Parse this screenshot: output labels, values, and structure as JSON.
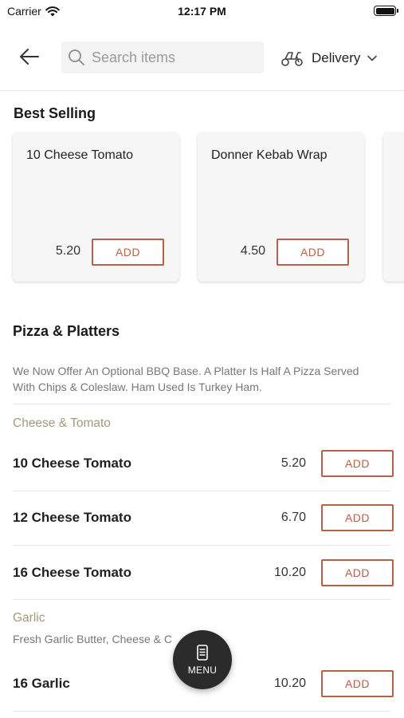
{
  "status_bar": {
    "carrier": "Carrier",
    "time": "12:17 PM"
  },
  "header": {
    "search_placeholder": "Search items",
    "delivery_label": "Delivery"
  },
  "best_selling": {
    "title": "Best Selling",
    "cards": [
      {
        "name": "10 Cheese Tomato",
        "price": "5.20",
        "add_label": "ADD"
      },
      {
        "name": "Donner Kebab Wrap",
        "price": "4.50",
        "add_label": "ADD"
      }
    ]
  },
  "pizza": {
    "title": "Pizza & Platters",
    "description": "We Now Offer An Optional BBQ Base. A Platter Is Half A Pizza Served With Chips & Coleslaw. Ham Used Is Turkey Ham.",
    "subcategories": [
      {
        "title": "Cheese & Tomato",
        "items": [
          {
            "name": "10 Cheese Tomato",
            "price": "5.20",
            "add_label": "ADD"
          },
          {
            "name": "12 Cheese Tomato",
            "price": "6.70",
            "add_label": "ADD"
          },
          {
            "name": "16 Cheese Tomato",
            "price": "10.20",
            "add_label": "ADD"
          }
        ]
      },
      {
        "title": "Garlic",
        "description": "Fresh Garlic Butter, Cheese & C",
        "items": [
          {
            "name": "16 Garlic",
            "price": "10.20",
            "add_label": "ADD"
          }
        ]
      }
    ]
  },
  "menu_fab": {
    "label": "MENU"
  },
  "colors": {
    "accent": "#b5604a",
    "subcategory": "#a8977a",
    "fab": "#2b2b2b"
  },
  "icons": [
    "wifi-icon",
    "battery-icon",
    "back-arrow-icon",
    "search-icon",
    "scooter-icon",
    "chevron-down-icon",
    "menu-book-icon"
  ]
}
